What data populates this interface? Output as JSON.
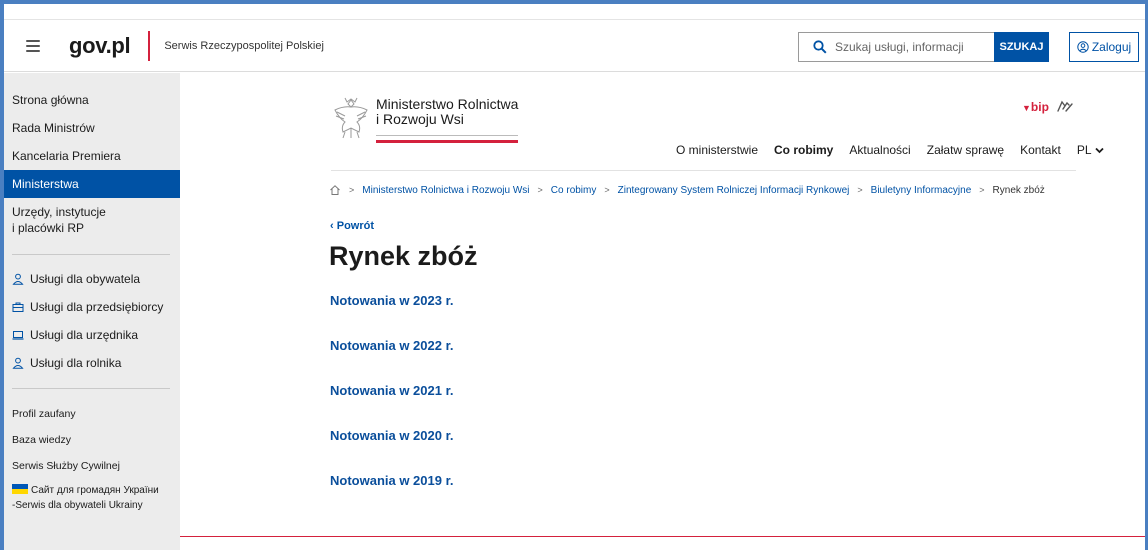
{
  "header": {
    "logo": "gov.pl",
    "service_name": "Serwis Rzeczypospolitej Polskiej",
    "search_placeholder": "Szukaj usługi, informacji",
    "search_button": "SZUKAJ",
    "login_label": "Zaloguj"
  },
  "sidebar": {
    "top_items": [
      {
        "label": "Strona główna"
      },
      {
        "label": "Rada Ministrów"
      },
      {
        "label": "Kancelaria Premiera"
      },
      {
        "label": "Ministerstwa"
      },
      {
        "label_line1": "Urzędy, instytucje",
        "label_line2": "i placówki RP"
      }
    ],
    "services": [
      {
        "label": "Usługi dla obywatela",
        "icon": "person-icon"
      },
      {
        "label": "Usługi dla przedsiębiorcy",
        "icon": "briefcase-icon"
      },
      {
        "label": "Usługi dla urzędnika",
        "icon": "laptop-icon"
      },
      {
        "label": "Usługi dla rolnika",
        "icon": "person-icon"
      }
    ],
    "bottom_items": [
      {
        "label": "Profil zaufany"
      },
      {
        "label": "Baza wiedzy"
      },
      {
        "label": "Serwis Służby Cywilnej"
      }
    ],
    "ukraine": {
      "line1": "Сайт для громадян України",
      "line2": "-Serwis dla obywateli Ukrainy"
    },
    "colors": {
      "active_bg": "#0052a5",
      "flag_blue": "#0057b7",
      "flag_yellow": "#ffd700"
    }
  },
  "ministry": {
    "name_line1": "Ministerstwo Rolnictwa",
    "name_line2": "i Rozwoju Wsi",
    "bip": "bip"
  },
  "nav": {
    "items": [
      "O ministerstwie",
      "Co robimy",
      "Aktualności",
      "Załatw sprawę",
      "Kontakt"
    ],
    "lang": "PL"
  },
  "breadcrumb": [
    "Ministerstwo Rolnictwa i Rozwoju Wsi",
    "Co robimy",
    "Zintegrowany System Rolniczej Informacji Rynkowej",
    "Biuletyny Informacyjne",
    "Rynek zbóż"
  ],
  "main": {
    "back_label": "Powrót",
    "title": "Rynek zbóż",
    "links": [
      "Notowania w 2023 r.",
      "Notowania w 2022 r.",
      "Notowania w 2021 r.",
      "Notowania w 2020 r.",
      "Notowania w 2019 r."
    ]
  },
  "colors": {
    "brand_blue": "#0052a5",
    "brand_red": "#d4213d"
  }
}
